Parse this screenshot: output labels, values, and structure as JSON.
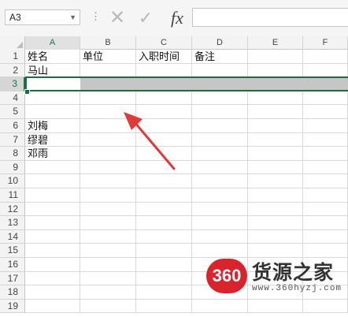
{
  "formula_bar": {
    "name_box_value": "A3",
    "cancel_icon": "x-icon",
    "enter_icon": "check-icon",
    "function_label": "fx",
    "formula_value": ""
  },
  "columns": [
    "A",
    "B",
    "C",
    "D",
    "E",
    "F"
  ],
  "rows": [
    {
      "num": "1",
      "cells": [
        "姓名",
        "单位",
        "入职时间",
        "备注",
        "",
        ""
      ]
    },
    {
      "num": "2",
      "cells": [
        "马山",
        "",
        "",
        "",
        "",
        ""
      ]
    },
    {
      "num": "3",
      "cells": [
        "",
        "",
        "",
        "",
        "",
        ""
      ]
    },
    {
      "num": "4",
      "cells": [
        "",
        "",
        "",
        "",
        "",
        ""
      ]
    },
    {
      "num": "5",
      "cells": [
        "",
        "",
        "",
        "",
        "",
        ""
      ]
    },
    {
      "num": "6",
      "cells": [
        "刘梅",
        "",
        "",
        "",
        "",
        ""
      ]
    },
    {
      "num": "7",
      "cells": [
        "缪碧",
        "",
        "",
        "",
        "",
        ""
      ]
    },
    {
      "num": "8",
      "cells": [
        "邓雨",
        "",
        "",
        "",
        "",
        ""
      ]
    },
    {
      "num": "9",
      "cells": [
        "",
        "",
        "",
        "",
        "",
        ""
      ]
    },
    {
      "num": "10",
      "cells": [
        "",
        "",
        "",
        "",
        "",
        ""
      ]
    },
    {
      "num": "11",
      "cells": [
        "",
        "",
        "",
        "",
        "",
        ""
      ]
    },
    {
      "num": "12",
      "cells": [
        "",
        "",
        "",
        "",
        "",
        ""
      ]
    },
    {
      "num": "13",
      "cells": [
        "",
        "",
        "",
        "",
        "",
        ""
      ]
    },
    {
      "num": "14",
      "cells": [
        "",
        "",
        "",
        "",
        "",
        ""
      ]
    },
    {
      "num": "15",
      "cells": [
        "",
        "",
        "",
        "",
        "",
        ""
      ]
    },
    {
      "num": "16",
      "cells": [
        "",
        "",
        "",
        "",
        "",
        ""
      ]
    },
    {
      "num": "17",
      "cells": [
        "",
        "",
        "",
        "",
        "",
        ""
      ]
    },
    {
      "num": "18",
      "cells": [
        "",
        "",
        "",
        "",
        "",
        ""
      ]
    },
    {
      "num": "19",
      "cells": [
        "",
        "",
        "",
        "",
        "",
        ""
      ]
    }
  ],
  "selection": {
    "active_cell": "A3",
    "selected_row": "3"
  },
  "watermark": {
    "logo_text": "360",
    "title": "货源之家",
    "url": "www.360hyzj.com",
    "logo_color": "#d9232d"
  },
  "colors": {
    "selection_border": "#1e6b41",
    "arrow": "#e03a3a"
  }
}
